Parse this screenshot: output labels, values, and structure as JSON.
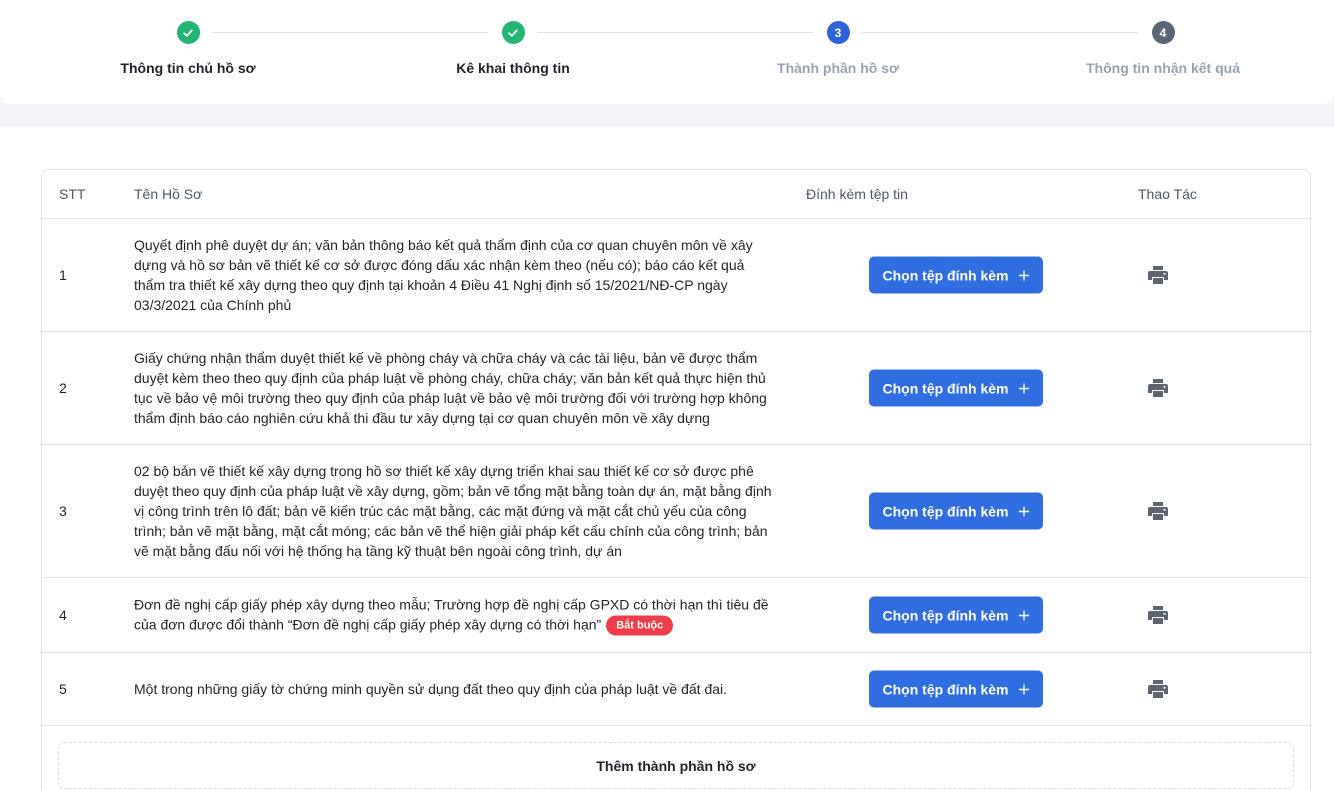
{
  "stepper": {
    "steps": [
      {
        "number": "",
        "label": "Thông tin chủ hồ sơ",
        "state": "done"
      },
      {
        "number": "",
        "label": "Kê khai thông tin",
        "state": "done"
      },
      {
        "number": "3",
        "label": "Thành phần hồ sơ",
        "state": "active"
      },
      {
        "number": "4",
        "label": "Thông tin nhận kết quả",
        "state": "todo"
      }
    ]
  },
  "table": {
    "headers": {
      "stt": "STT",
      "name": "Tên Hồ Sơ",
      "attach": "Đính kèm tệp tin",
      "actions": "Thao Tác"
    },
    "attach_button_label": "Chọn tệp đính kèm",
    "rows": [
      {
        "stt": "1",
        "name": "Quyết định phê duyệt dự án; văn bản thông báo kết quả thẩm định của cơ quan chuyên môn về xây dựng và hồ sơ bản vẽ thiết kế cơ sở được đóng dấu xác nhận kèm theo (nếu có); báo cáo kết quả thẩm tra thiết kế xây dựng theo quy định tại khoản 4 Điều 41 Nghị định số 15/2021/NĐ-CP ngày 03/3/2021 của Chính phủ",
        "badge": ""
      },
      {
        "stt": "2",
        "name": "Giấy chứng nhận thẩm duyệt thiết kế về phòng cháy và chữa cháy và các tài liệu, bản vẽ được thẩm duyệt kèm theo theo quy định của pháp luật về phòng cháy, chữa cháy; văn bản kết quả thực hiện thủ tục về bảo vệ môi trường theo quy định của pháp luật về bảo vệ môi trường đối với trường hợp không thẩm định báo cáo nghiên cứu khả thi đầu tư xây dựng tại cơ quan chuyên môn về xây dựng",
        "badge": ""
      },
      {
        "stt": "3",
        "name": "02 bộ bản vẽ thiết kế xây dựng trong hồ sơ thiết kế xây dựng triển khai sau thiết kế cơ sở được phê duyệt theo quy định của pháp luật về xây dựng, gồm; bản vẽ tổng mặt bằng toàn dự án, mặt bằng định vị công trình trên lô đất; bản vẽ kiến trúc các mặt bằng, các mặt đứng và mặt cắt chủ yếu của công trình; bản vẽ mặt bằng, mặt cắt móng; các bản vẽ thể hiện giải pháp kết cấu chính của công trình; bản vẽ mặt bằng đấu nối với hệ thống hạ tầng kỹ thuật bên ngoài công trình, dự án",
        "badge": ""
      },
      {
        "stt": "4",
        "name": "Đơn đề nghị cấp giấy phép xây dựng theo mẫu; Trường hợp đề nghị cấp GPXD có thời hạn thì tiêu đề của đơn được đổi thành “Đơn đề nghị cấp giấy phép xây dựng có thời hạn”",
        "badge": "Bắt buộc"
      },
      {
        "stt": "5",
        "name": "Một trong những giấy tờ chứng minh quyền sử dụng đất theo quy định của pháp luật về đất đai.",
        "badge": ""
      }
    ],
    "add_component_label": "Thêm thành phần hồ sơ"
  },
  "colors": {
    "done": "#22b573",
    "active": "#2f64d8",
    "todo": "#5b6675",
    "primary_button": "#2f6de0",
    "badge_required": "#ee3d48"
  }
}
